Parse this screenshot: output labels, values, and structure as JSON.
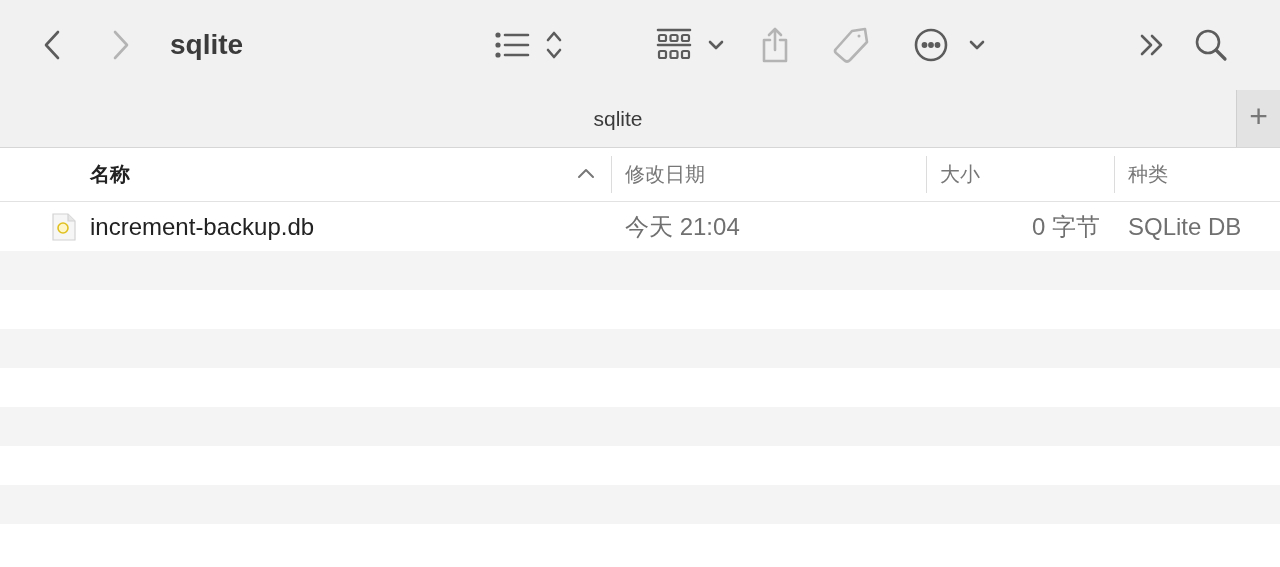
{
  "toolbar": {
    "title": "sqlite",
    "items": [
      {
        "kind": "back",
        "disabled": false
      },
      {
        "kind": "forward",
        "disabled": true
      },
      {
        "kind": "title"
      },
      {
        "kind": "view-list",
        "disabled": false
      },
      {
        "kind": "view-grid",
        "disabled": false
      },
      {
        "kind": "share",
        "disabled": true
      },
      {
        "kind": "tag",
        "disabled": true
      },
      {
        "kind": "more",
        "disabled": false
      },
      {
        "kind": "overflow",
        "disabled": false
      },
      {
        "kind": "search",
        "disabled": false
      }
    ]
  },
  "tab_bar": {
    "title": "sqlite",
    "add_button": "+"
  },
  "table": {
    "columns": [
      {
        "label": "名称",
        "sorted": true
      },
      {
        "label": "修改日期",
        "sorted": false
      },
      {
        "label": "大小",
        "sorted": false
      },
      {
        "label": "种类",
        "sorted": false
      }
    ],
    "rows": [
      {
        "cells": [
          "increment-backup.db",
          "今天 21:04",
          "0 字节",
          "SQLite DB"
        ]
      }
    ]
  }
}
